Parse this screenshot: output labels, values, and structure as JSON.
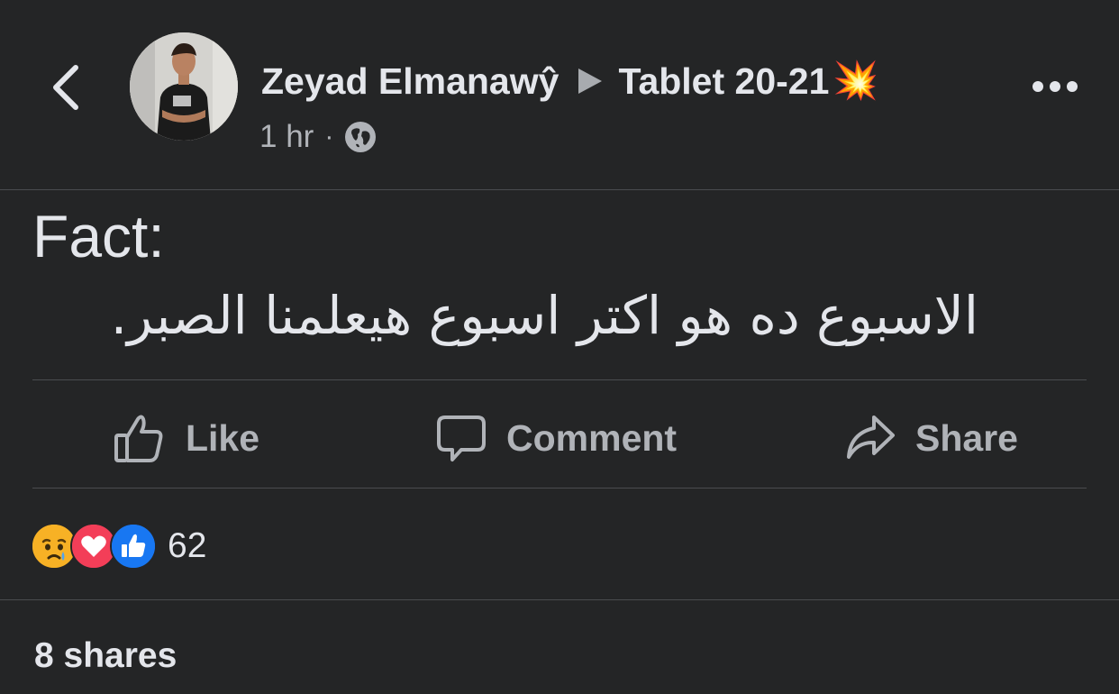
{
  "post": {
    "author": "Zeyad Elmanawŷ",
    "group": "Tablet 20-21",
    "group_emoji": "💥",
    "time": "1 hr",
    "separator": "·",
    "privacy_icon": "globe-icon",
    "text_line1": "Fact:",
    "text_line2": "الاسبوع ده هو اكتر اسبوع هيعلمنا الصبر."
  },
  "actions": {
    "like_label": "Like",
    "comment_label": "Comment",
    "share_label": "Share"
  },
  "reactions": {
    "types": [
      "sad",
      "love",
      "like"
    ],
    "count": "62"
  },
  "shares_text": "8 shares",
  "colors": {
    "background": "#242526",
    "primary_text": "#e4e6eb",
    "secondary_text": "#b0b3b8",
    "divider": "#4a4c4f",
    "like_blue": "#1877f2",
    "love_red": "#f33e58",
    "sad_yellow": "#f7b125"
  }
}
